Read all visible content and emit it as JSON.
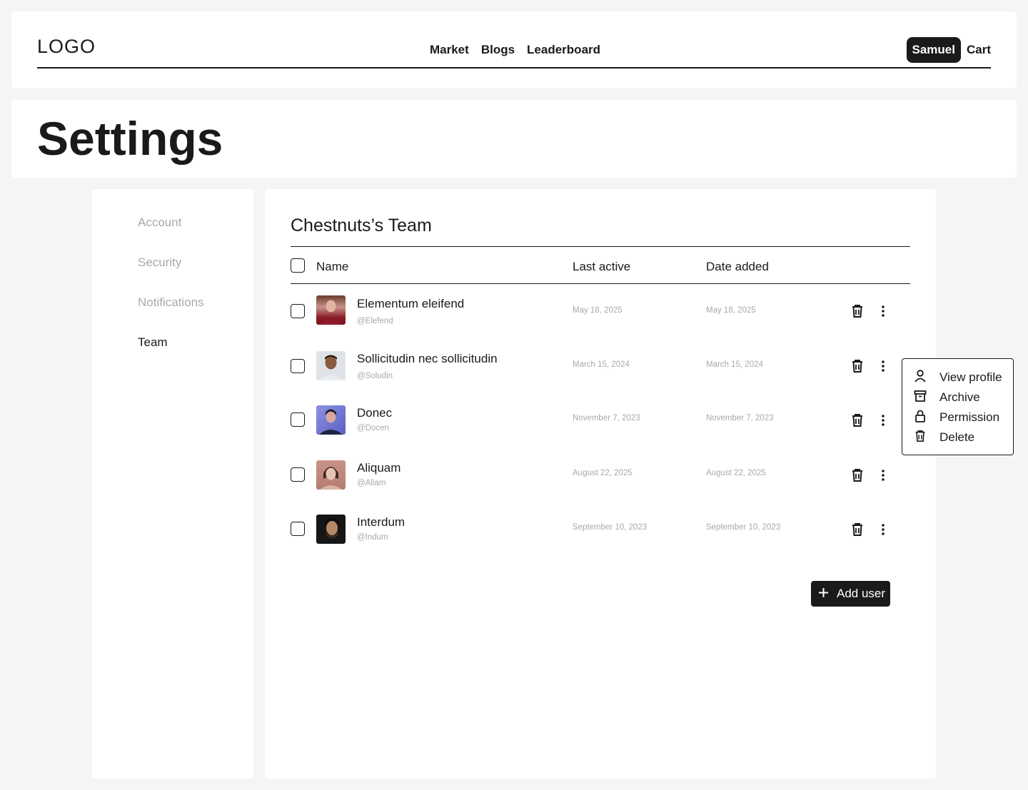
{
  "header": {
    "logo": "LOGO",
    "nav": [
      "Market",
      "Blogs",
      "Leaderboard"
    ],
    "user": "Samuel",
    "cart": "Cart"
  },
  "page": {
    "title": "Settings"
  },
  "sidebar": {
    "items": [
      {
        "label": "Account",
        "active": false
      },
      {
        "label": "Security",
        "active": false
      },
      {
        "label": "Notifications",
        "active": false
      },
      {
        "label": "Team",
        "active": true
      }
    ]
  },
  "team": {
    "title": "Chestnuts’s Team",
    "columns": {
      "name": "Name",
      "last_active": "Last active",
      "date_added": "Date added"
    },
    "members": [
      {
        "name": "Elementum eleifend",
        "handle": "@Elefend",
        "last_active": "May 18, 2025",
        "date_added": "May 18, 2025"
      },
      {
        "name": "Sollicitudin nec sollicitudin",
        "handle": "@Soludin",
        "last_active": "March 15, 2024",
        "date_added": "March 15, 2024"
      },
      {
        "name": "Donec",
        "handle": "@Docen",
        "last_active": "November 7, 2023",
        "date_added": "November 7, 2023"
      },
      {
        "name": "Aliquam",
        "handle": "@Aliam",
        "last_active": "August 22, 2025",
        "date_added": "August 22, 2025"
      },
      {
        "name": "Interdum",
        "handle": "@Indum",
        "last_active": "September 10, 2023",
        "date_added": "September 10, 2023"
      }
    ],
    "add_user_label": "Add user"
  },
  "menu": {
    "items": [
      {
        "label": "View profile",
        "icon": "user-icon"
      },
      {
        "label": "Archive",
        "icon": "archive-icon"
      },
      {
        "label": "Permission",
        "icon": "lock-icon"
      },
      {
        "label": "Delete",
        "icon": "trash-icon"
      }
    ]
  }
}
